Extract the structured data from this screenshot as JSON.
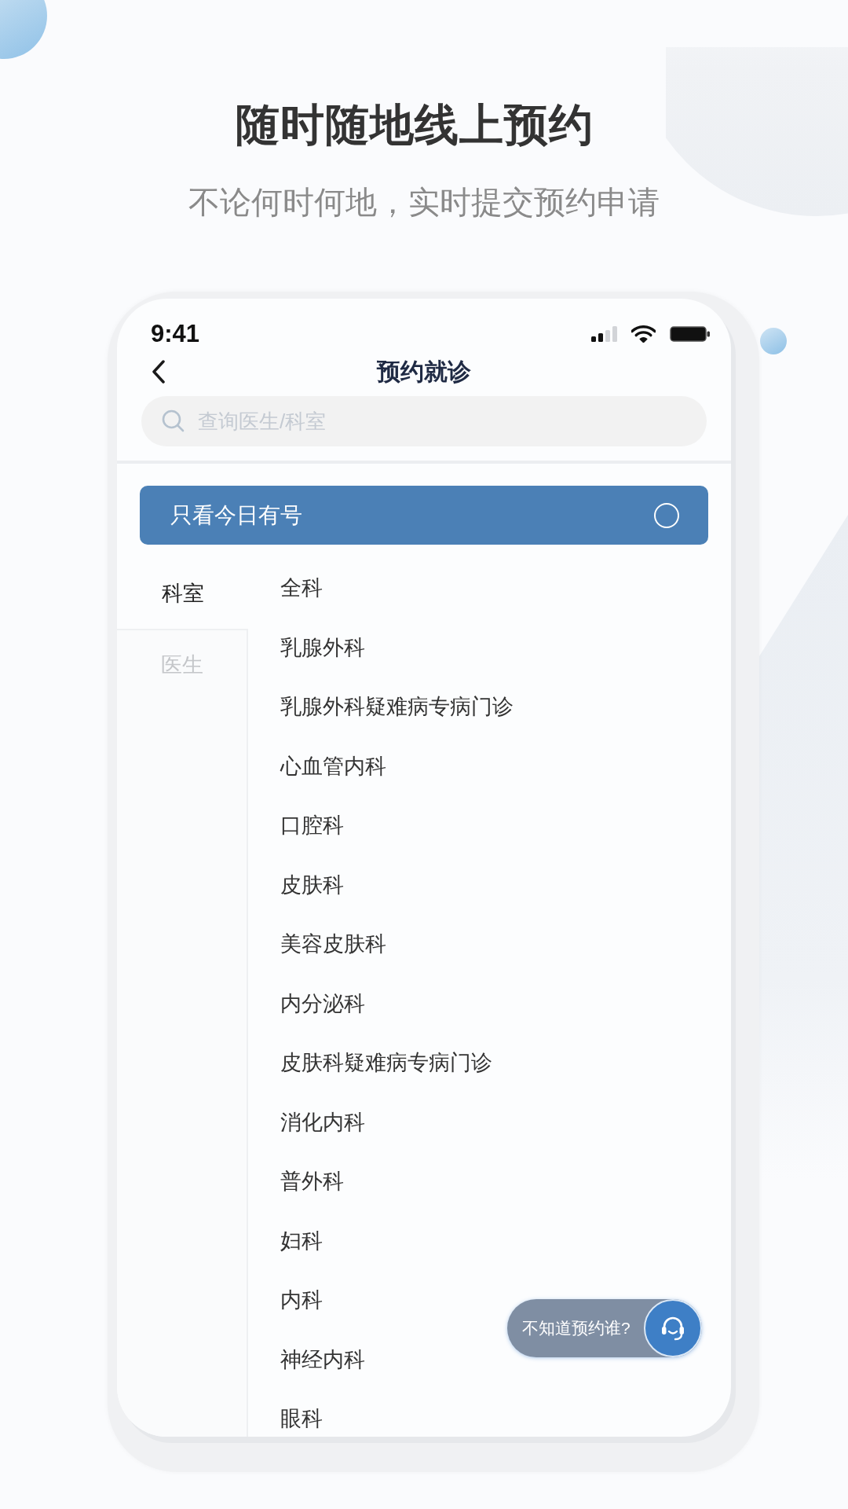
{
  "header": {
    "title": "随时随地线上预约",
    "subtitle": "不论何时何地，实时提交预约申请"
  },
  "status_bar": {
    "time": "9:41"
  },
  "nav_bar": {
    "title": "预约就诊"
  },
  "search": {
    "placeholder": "查询医生/科室"
  },
  "filter_banner": {
    "label": "只看今日有号",
    "checked": false
  },
  "tabs": [
    {
      "label": "科室",
      "selected": true
    },
    {
      "label": "医生",
      "selected": false
    }
  ],
  "departments": [
    "全科",
    "乳腺外科",
    "乳腺外科疑难病专病门诊",
    "心血管内科",
    "口腔科",
    "皮肤科",
    "美容皮肤科",
    "内分泌科",
    "皮肤科疑难病专病门诊",
    "消化内科",
    "普外科",
    "妇科",
    "内科",
    "神经内科",
    "眼科"
  ],
  "help_button": {
    "label": "不知道预约谁?"
  }
}
